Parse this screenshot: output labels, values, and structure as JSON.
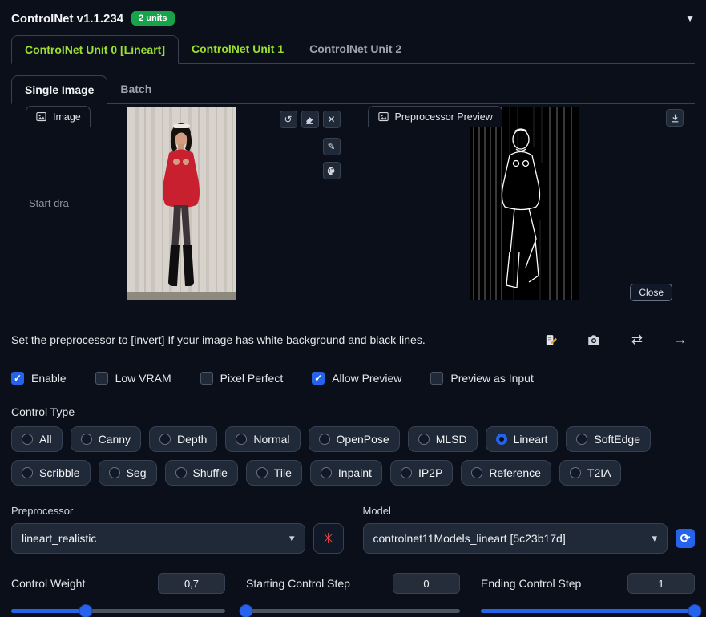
{
  "header": {
    "title": "ControlNet v1.1.234",
    "badge": "2 units"
  },
  "icons": {
    "collapse": "▼",
    "undo": "↺",
    "clear": "✕",
    "sketch": "✎",
    "swap": "⇄",
    "send": "→",
    "caret": "▾",
    "explosion": "✳",
    "refresh": "⟳"
  },
  "unit_tabs": [
    {
      "label": "ControlNet Unit 0 [Lineart]",
      "active": true
    },
    {
      "label": "ControlNet Unit 1",
      "active": false
    },
    {
      "label": "ControlNet Unit 2",
      "active": false
    }
  ],
  "mode_tabs": [
    {
      "label": "Single Image",
      "active": true
    },
    {
      "label": "Batch",
      "active": false
    }
  ],
  "image_panel": {
    "label": "Image",
    "hint": "Start dra"
  },
  "preview_panel": {
    "label": "Preprocessor Preview",
    "close_label": "Close"
  },
  "note": "Set the preprocessor to [invert] If your image has white background and black lines.",
  "checkboxes": [
    {
      "label": "Enable",
      "checked": true
    },
    {
      "label": "Low VRAM",
      "checked": false
    },
    {
      "label": "Pixel Perfect",
      "checked": false
    },
    {
      "label": "Allow Preview",
      "checked": true
    },
    {
      "label": "Preview as Input",
      "checked": false
    }
  ],
  "control_type": {
    "label": "Control Type",
    "selected": "Lineart",
    "options": [
      "All",
      "Canny",
      "Depth",
      "Normal",
      "OpenPose",
      "MLSD",
      "Lineart",
      "SoftEdge",
      "Scribble",
      "Seg",
      "Shuffle",
      "Tile",
      "Inpaint",
      "IP2P",
      "Reference",
      "T2IA"
    ]
  },
  "preprocessor": {
    "label": "Preprocessor",
    "value": "lineart_realistic"
  },
  "model": {
    "label": "Model",
    "value": "controlnet11Models_lineart [5c23b17d]"
  },
  "sliders": [
    {
      "label": "Control Weight",
      "value": "0,7",
      "percent": 35
    },
    {
      "label": "Starting Control Step",
      "value": "0",
      "percent": 0
    },
    {
      "label": "Ending Control Step",
      "value": "1",
      "percent": 100
    }
  ]
}
